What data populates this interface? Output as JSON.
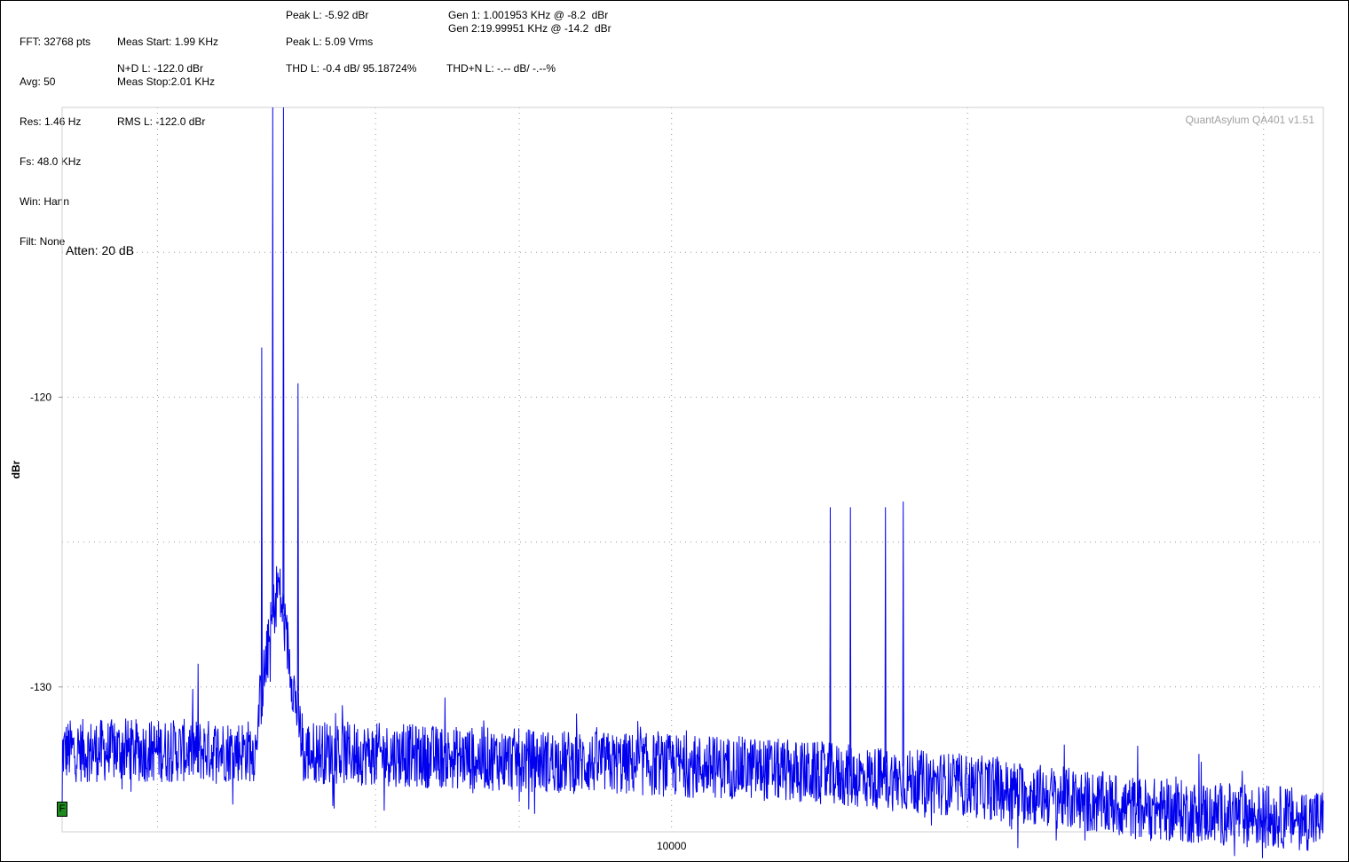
{
  "header": {
    "col1": [
      "FFT: 32768 pts",
      "Avg: 50",
      "Res: 1.46 Hz",
      "Fs: 48.0 KHz",
      "Win: Hann",
      "Filt: None"
    ],
    "meas_start": "Meas Start: 1.99 KHz",
    "meas_stop": "Meas Stop:2.01 KHz",
    "rms": "RMS L: -122.0 dBr",
    "nd": "N+D L: -122.0 dBr",
    "peak_dbr": "Peak L: -5.92 dBr",
    "peak_vrms": "Peak L: 5.09 Vrms",
    "thd": "THD L: -0.4 dB/ 95.18724%",
    "gen1": "Gen 1: 1.001953 KHz @ -8.2  dBr",
    "gen2": "Gen 2:19.99951 KHz @ -14.2  dBr",
    "thdn": "THD+N L: -.-- dB/ -.--%"
  },
  "watermark": "QuantAsylum QA401 v1.51",
  "atten": "Atten: 20 dB",
  "marker_label": "F",
  "colors": {
    "trace": "#0000ee",
    "grid": "#999999",
    "marker": "#1f8a1f"
  },
  "chart_data": {
    "type": "line",
    "title": "",
    "xlabel": "",
    "ylabel": "dBr",
    "x_scale": "log",
    "xlim": [
      2400,
      46000
    ],
    "ylim": [
      -135,
      -110
    ],
    "x_ticks": [
      {
        "value": 10000,
        "label": "10000"
      }
    ],
    "y_ticks": [
      {
        "value": -120,
        "label": "-120"
      },
      {
        "value": -130,
        "label": "-130"
      }
    ],
    "grid": true,
    "series": [
      {
        "values_description_excluded": true,
        "noise_floor": [
          [
            2400,
            -132.2
          ],
          [
            4000,
            -132.2
          ],
          [
            8000,
            -132.6
          ],
          [
            12000,
            -132.8
          ],
          [
            20000,
            -133.4
          ],
          [
            30000,
            -134.2
          ],
          [
            46000,
            -134.6
          ]
        ],
        "peaks": [
          {
            "x": 3300,
            "y": -129.2
          },
          {
            "x": 3830,
            "y": -120.3
          },
          {
            "x": 3930,
            "y": -109.5
          },
          {
            "x": 4030,
            "y": -109.5
          },
          {
            "x": 4170,
            "y": -120.7
          },
          {
            "x": 14500,
            "y": -123.8
          },
          {
            "x": 15200,
            "y": -123.8
          },
          {
            "x": 16500,
            "y": -123.8
          },
          {
            "x": 17200,
            "y": -123.6
          }
        ]
      }
    ]
  }
}
